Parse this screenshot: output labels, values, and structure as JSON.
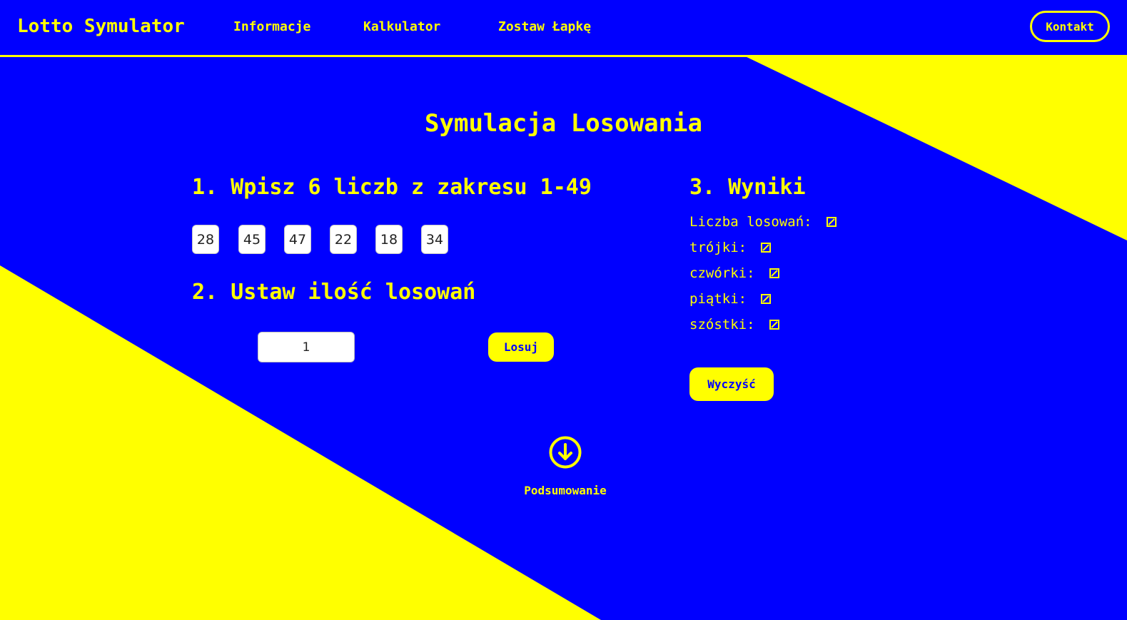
{
  "colors": {
    "background": "#0000ff",
    "accent": "#ffff00",
    "input_bg": "#ffffff"
  },
  "nav": {
    "brand": "Lotto Symulator",
    "links": [
      "Informacje",
      "Kalkulator",
      "Zostaw Łapkę"
    ],
    "contact_label": "Kontakt"
  },
  "main": {
    "title": "Symulacja Losowania",
    "step1_heading": "1. Wpisz 6 liczb z zakresu 1-49",
    "numbers": [
      "28",
      "45",
      "47",
      "22",
      "18",
      "34"
    ],
    "step2_heading": "2. Ustaw ilość losowań",
    "draw_count_value": "1",
    "draw_button_label": "Losuj",
    "step3_heading": "3. Wyniki",
    "results": [
      {
        "label": "Liczba losowań:",
        "icon": "broken-value-icon"
      },
      {
        "label": "trójki:",
        "icon": "broken-value-icon"
      },
      {
        "label": "czwórki:",
        "icon": "broken-value-icon"
      },
      {
        "label": "piątki:",
        "icon": "broken-value-icon"
      },
      {
        "label": "szóstki:",
        "icon": "broken-value-icon"
      }
    ],
    "clear_button_label": "Wyczyść",
    "summary_label": "Podsumowanie",
    "summary_icon": "arrow-down-circle-icon"
  }
}
